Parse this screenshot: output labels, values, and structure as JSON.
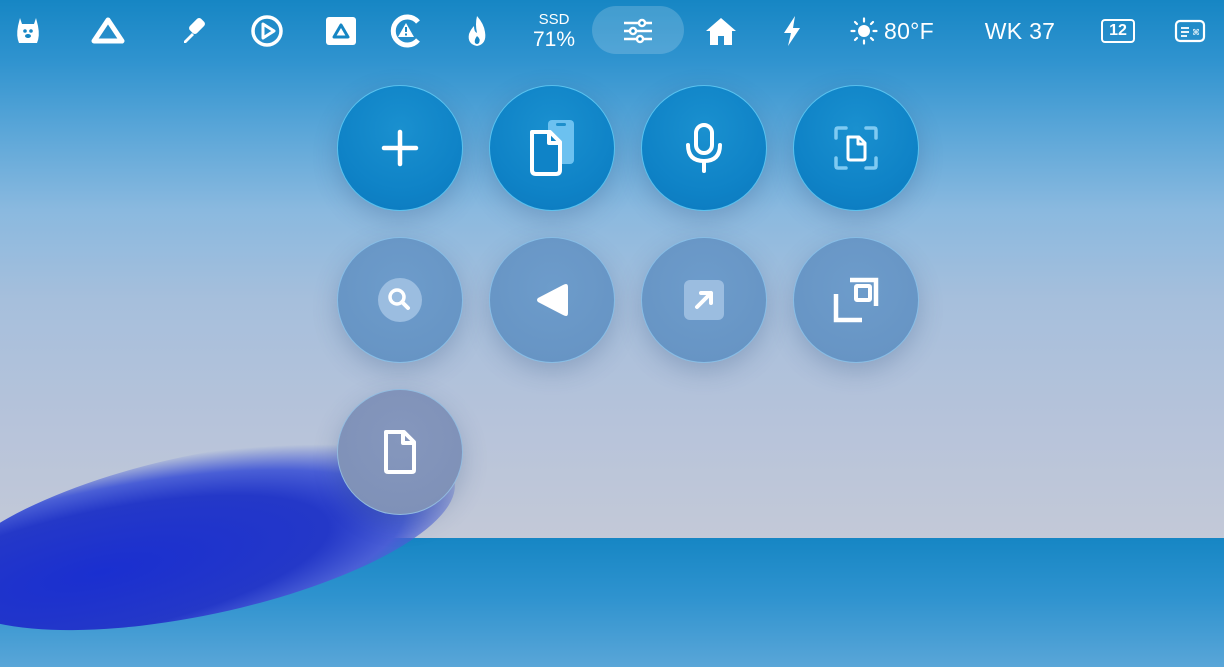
{
  "menubar": {
    "ssd_label": "SSD",
    "ssd_value": "71%",
    "weather": "80°F",
    "week": "WK 37",
    "calendar_day": "12",
    "icons": [
      "alpaca-icon",
      "delta-icon",
      "eyedropper-icon",
      "elgato-icon",
      "drive-icon",
      "warning-c-icon",
      "flame-icon",
      "sliders-icon",
      "home-icon",
      "bolt-icon",
      "sun-icon",
      "calendar-icon",
      "keyboard-shortcut-icon"
    ]
  },
  "panel": {
    "buttons": [
      {
        "name": "new-button",
        "icon": "plus-icon"
      },
      {
        "name": "clipboard-button",
        "icon": "document-phone-icon"
      },
      {
        "name": "dictation-button",
        "icon": "microphone-icon"
      },
      {
        "name": "scan-document-button",
        "icon": "document-scan-icon"
      },
      {
        "name": "search-button",
        "icon": "magnifier-icon"
      },
      {
        "name": "back-button",
        "icon": "triangle-left-icon"
      },
      {
        "name": "open-link-button",
        "icon": "arrow-up-right-icon"
      },
      {
        "name": "resize-button",
        "icon": "expand-corners-icon"
      },
      {
        "name": "document-button",
        "icon": "document-icon"
      }
    ]
  },
  "colors": {
    "accent_blue": "#0f83c7",
    "button_grey": "#6592c2"
  }
}
